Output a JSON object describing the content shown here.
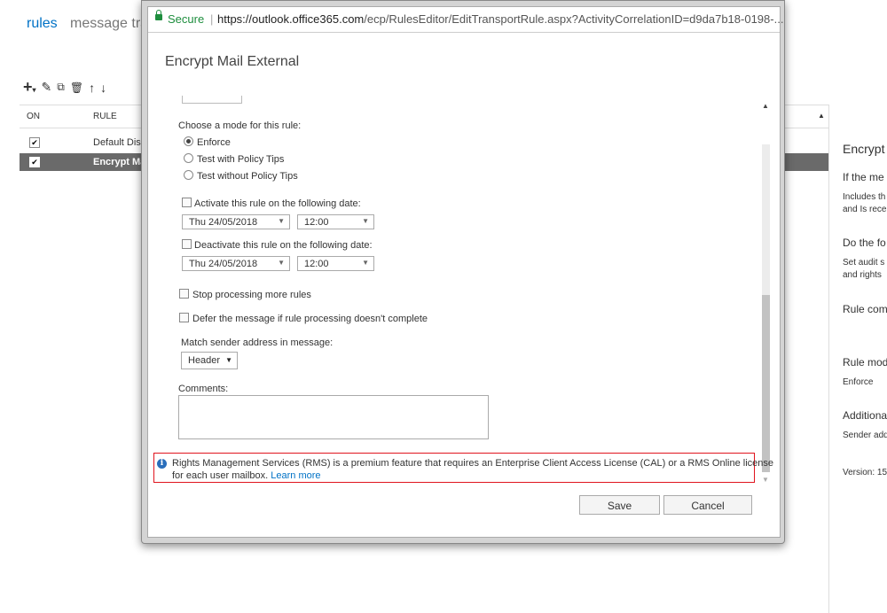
{
  "background": {
    "tabs": [
      "rules",
      "message tra"
    ],
    "grid": {
      "columns": [
        "ON",
        "RULE"
      ],
      "rows": [
        {
          "name": "Default Dis",
          "enabled": true,
          "selected": false
        },
        {
          "name": "Encrypt Ma",
          "enabled": true,
          "selected": true
        }
      ]
    },
    "details_panel": {
      "title": "Encrypt",
      "if_heading": "If the me",
      "if_line1": "Includes th",
      "if_line2": "and Is rece",
      "do_heading": "Do the fo",
      "do_line1": "Set audit s",
      "do_line2": "and rights",
      "comments_heading": "Rule com",
      "mode_heading": "Rule mod",
      "mode_value": "Enforce",
      "additional_heading": "Additiona",
      "additional_value": "Sender add",
      "version": "Version: 15"
    }
  },
  "browser": {
    "secure_label": "Secure",
    "url_host": "https://outlook.office365.com",
    "url_path": "/ecp/RulesEditor/EditTransportRule.aspx?ActivityCorrelationID=d9da7b18-0198-..."
  },
  "dialog": {
    "title": "Encrypt Mail External",
    "mode_label": "Choose a mode for this rule:",
    "modes": [
      {
        "label": "Enforce",
        "selected": true
      },
      {
        "label": "Test with Policy Tips",
        "selected": false
      },
      {
        "label": "Test without Policy Tips",
        "selected": false
      }
    ],
    "activate_label": "Activate this rule on the following date:",
    "activate_date": "Thu 24/05/2018",
    "activate_time": "12:00",
    "deactivate_label": "Deactivate this rule on the following date:",
    "deactivate_date": "Thu 24/05/2018",
    "deactivate_time": "12:00",
    "stop_label": "Stop processing more rules",
    "defer_label": "Defer the message if rule processing doesn't complete",
    "match_label": "Match sender address in message:",
    "match_value": "Header",
    "comments_label": "Comments:",
    "notice_line1": "Rights Management Services (RMS) is a premium feature that requires an Enterprise Client Access License (CAL) or a RMS Online license",
    "notice_line2": "for each user mailbox.",
    "learn_more": "Learn more",
    "save": "Save",
    "cancel": "Cancel"
  }
}
